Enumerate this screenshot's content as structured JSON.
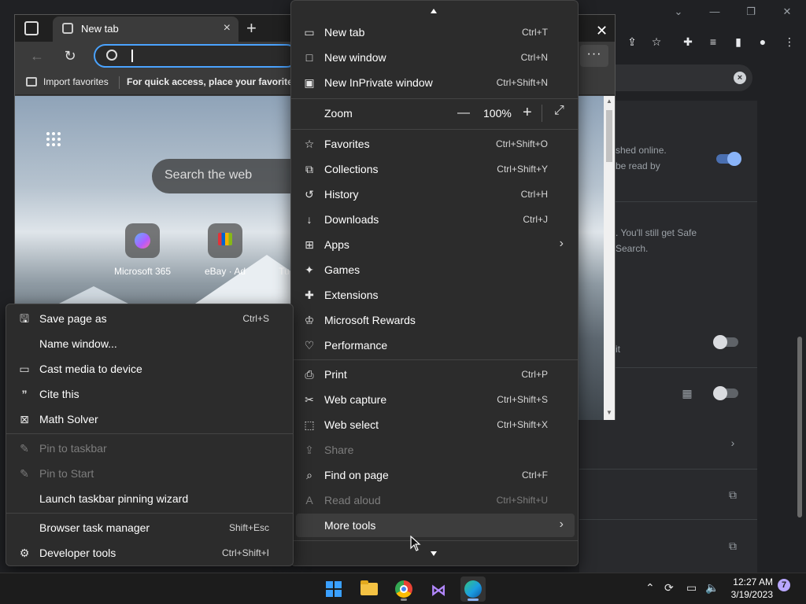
{
  "edge": {
    "tab_title": "New tab",
    "favorites_bar": {
      "import_label": "Import favorites",
      "hint": "For quick access, place your favorites h"
    },
    "content": {
      "search_placeholder": "Search the web",
      "quick_links": [
        {
          "label": "Microsoft 365"
        },
        {
          "label": "eBay · Ad"
        },
        {
          "label": "Tu"
        }
      ]
    }
  },
  "menu": {
    "items": [
      {
        "label": "New tab",
        "shortcut": "Ctrl+T"
      },
      {
        "label": "New window",
        "shortcut": "Ctrl+N"
      },
      {
        "label": "New InPrivate window",
        "shortcut": "Ctrl+Shift+N"
      },
      {
        "label": "Zoom",
        "value": "100%"
      },
      {
        "label": "Favorites",
        "shortcut": "Ctrl+Shift+O"
      },
      {
        "label": "Collections",
        "shortcut": "Ctrl+Shift+Y"
      },
      {
        "label": "History",
        "shortcut": "Ctrl+H"
      },
      {
        "label": "Downloads",
        "shortcut": "Ctrl+J"
      },
      {
        "label": "Apps"
      },
      {
        "label": "Games"
      },
      {
        "label": "Extensions"
      },
      {
        "label": "Microsoft Rewards"
      },
      {
        "label": "Performance"
      },
      {
        "label": "Print",
        "shortcut": "Ctrl+P"
      },
      {
        "label": "Web capture",
        "shortcut": "Ctrl+Shift+S"
      },
      {
        "label": "Web select",
        "shortcut": "Ctrl+Shift+X"
      },
      {
        "label": "Share"
      },
      {
        "label": "Find on page",
        "shortcut": "Ctrl+F"
      },
      {
        "label": "Read aloud",
        "shortcut": "Ctrl+Shift+U"
      },
      {
        "label": "More tools"
      }
    ]
  },
  "submenu": {
    "items": [
      {
        "label": "Save page as",
        "shortcut": "Ctrl+S"
      },
      {
        "label": "Name window..."
      },
      {
        "label": "Cast media to device"
      },
      {
        "label": "Cite this"
      },
      {
        "label": "Math Solver"
      },
      {
        "label": "Pin to taskbar"
      },
      {
        "label": "Pin to Start"
      },
      {
        "label": "Launch taskbar pinning wizard"
      },
      {
        "label": "Browser task manager",
        "shortcut": "Shift+Esc"
      },
      {
        "label": "Developer tools",
        "shortcut": "Ctrl+Shift+I"
      }
    ]
  },
  "background": {
    "text_1": "shed online.",
    "text_2": "be read by",
    "text_3": ". You'll still get Safe",
    "text_4": "Search.",
    "text_5": "it"
  },
  "taskbar": {
    "time": "12:27 AM",
    "date": "3/19/2023",
    "notifications": "7"
  },
  "colors": {
    "accent": "#4aa3ff",
    "menu_bg": "#2c2c2c",
    "toggle_on": "#8ab4f8"
  }
}
